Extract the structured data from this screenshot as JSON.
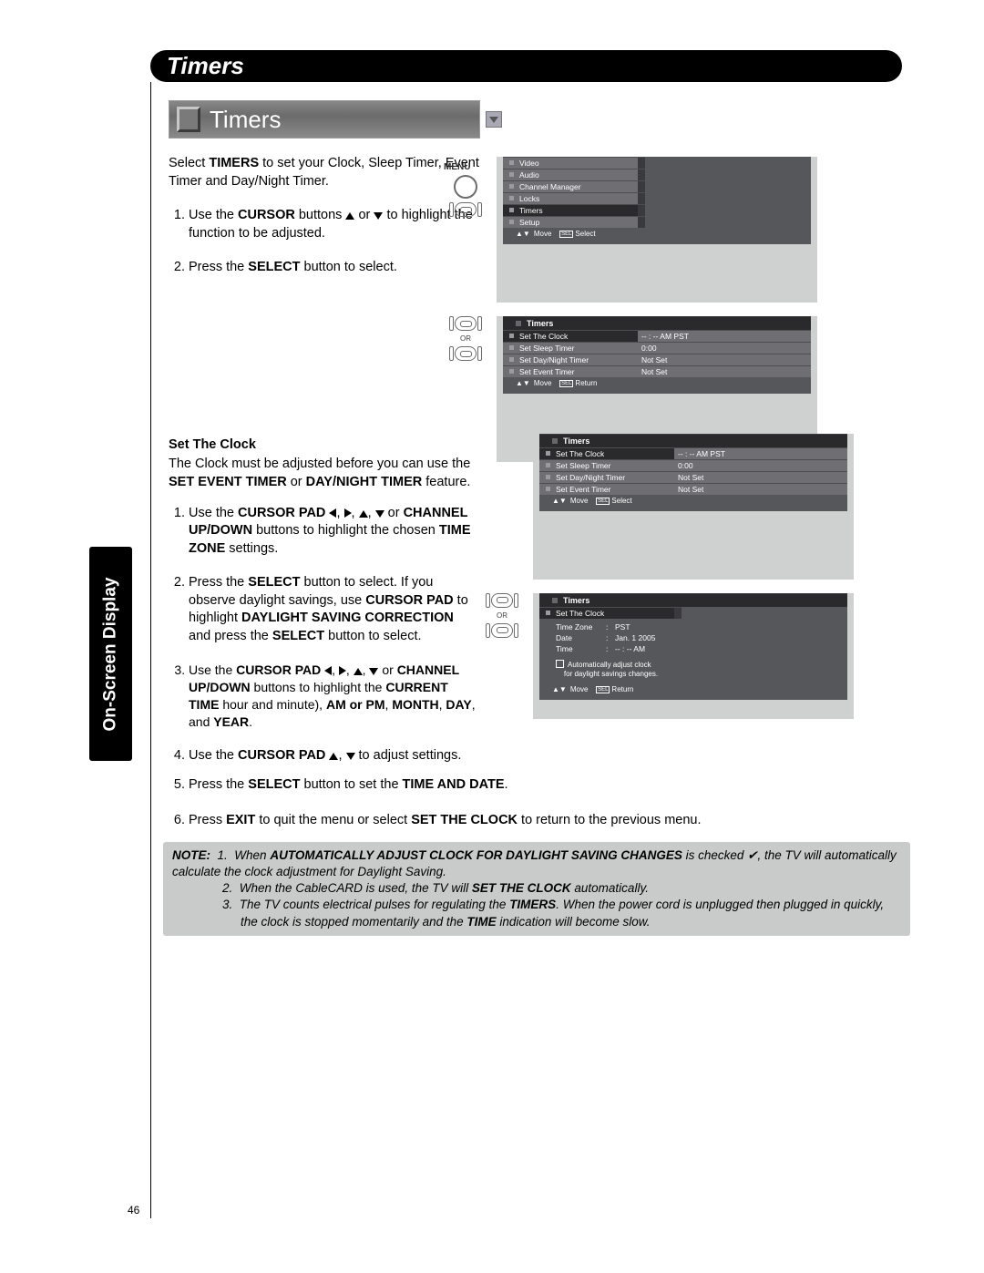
{
  "header": {
    "title": "Timers"
  },
  "sidebar": {
    "label": "On-Screen Display"
  },
  "page_number": "46",
  "section_timers": {
    "banner": "Timers",
    "intro_a": "Select ",
    "intro_b": "TIMERS",
    "intro_c": " to set your Clock, Sleep Timer, Event Timer and Day/Night Timer.",
    "steps": [
      {
        "a": "Use the ",
        "b": "CURSOR",
        "c": " buttons ",
        "d": " or ",
        "e": " to highlight the function to be adjusted."
      },
      {
        "a": "Press the ",
        "b": "SELECT",
        "c": " button to select."
      }
    ]
  },
  "section_clock": {
    "heading": "Set The Clock",
    "intro_a": "The Clock must be adjusted before you can use the ",
    "intro_b": "SET EVENT TIMER",
    "intro_c": " or ",
    "intro_d": "DAY/NIGHT TIMER",
    "intro_e": " feature.",
    "steps": [
      {
        "a": "Use the ",
        "b": "CURSOR PAD ",
        "c": " or ",
        "d": "CHANNEL UP/DOWN",
        "e": " buttons to highlight the chosen ",
        "f": "TIME ZONE",
        "g": " settings."
      },
      {
        "a": "Press the ",
        "b": "SELECT",
        "c": " button to select. If you observe daylight savings, use ",
        "d": "CURSOR PAD",
        "e": " to highlight ",
        "f": "DAYLIGHT SAVING CORRECTION",
        "g": " and press the ",
        "h": "SELECT",
        "i": " button to select."
      },
      {
        "a": "Use the ",
        "b": "CURSOR PAD ",
        "c": " or ",
        "d": "CHANNEL UP/DOWN",
        "e": " buttons to highlight the ",
        "f": "CURRENT TIME",
        "g": " hour and minute), ",
        "h": "AM or PM",
        "i": ", ",
        "j": "MONTH",
        "k": ", ",
        "l": "DAY",
        "m": ", and ",
        "n": "YEAR",
        "o": "."
      },
      {
        "a": "Use the ",
        "b": "CURSOR PAD ",
        "c": " to adjust settings."
      },
      {
        "a": "Press the ",
        "b": "SELECT",
        "c": " button to set the ",
        "d": "TIME AND DATE",
        "e": "."
      },
      {
        "a": "Press ",
        "b": "EXIT",
        "c": " to quit the menu or select ",
        "d": "SET THE CLOCK",
        "e": " to return to the previous menu."
      }
    ]
  },
  "note": {
    "label": "NOTE:",
    "items": [
      {
        "n": "1.",
        "a": "When ",
        "b": "AUTOMATICALLY ADJUST CLOCK FOR DAYLIGHT SAVING CHANGES",
        "c": " is checked ✔, the TV will automatically calculate the clock adjustment for Daylight Saving."
      },
      {
        "n": "2.",
        "a": "When the CableCARD is used, the TV will ",
        "b": "SET THE CLOCK",
        "c": " automatically."
      },
      {
        "n": "3.",
        "a": "The TV counts electrical pulses for regulating the ",
        "b": "TIMERS",
        "c": ". When the power cord is unplugged then plugged in quickly, the clock is stopped momentarily and the ",
        "d": "TIME",
        "e": " indication will become slow."
      }
    ]
  },
  "osd": {
    "menu_label": "MENU",
    "or_label": "OR",
    "panel1": {
      "items": [
        "Video",
        "Audio",
        "Channel Manager",
        "Locks",
        "Timers",
        "Setup"
      ],
      "highlight": 4,
      "nav_move": "Move",
      "nav_sel": "SEL",
      "nav_action": "Select"
    },
    "panel2": {
      "title": "Timers",
      "rows": [
        {
          "lbl": "Set The Clock",
          "val": "-- : -- AM PST",
          "hl": true
        },
        {
          "lbl": "Set Sleep Timer",
          "val": "0:00"
        },
        {
          "lbl": "Set Day/Night Timer",
          "val": "Not Set"
        },
        {
          "lbl": "Set Event Timer",
          "val": "Not Set"
        }
      ],
      "nav_move": "Move",
      "nav_sel": "SEL",
      "nav_action": "Return"
    },
    "panel3": {
      "title": "Timers",
      "rows": [
        {
          "lbl": "Set The Clock",
          "val": "-- : -- AM PST",
          "hl": true
        },
        {
          "lbl": "Set Sleep Timer",
          "val": "0:00"
        },
        {
          "lbl": "Set Day/Night Timer",
          "val": "Not Set"
        },
        {
          "lbl": "Set Event Timer",
          "val": "Not Set"
        }
      ],
      "nav_move": "Move",
      "nav_sel": "SEL",
      "nav_action": "Select"
    },
    "panel4": {
      "title": "Timers",
      "sub": "Set The Clock",
      "details": [
        {
          "k": "Time Zone",
          "v": "PST"
        },
        {
          "k": "Date",
          "v": "Jan. 1 2005"
        },
        {
          "k": "Time",
          "v": "-- : -- AM"
        }
      ],
      "check_a": "Automatically adjust clock",
      "check_b": "for daylight savings changes.",
      "nav_move": "Move",
      "nav_sel": "SEL",
      "nav_action": "Return"
    }
  }
}
